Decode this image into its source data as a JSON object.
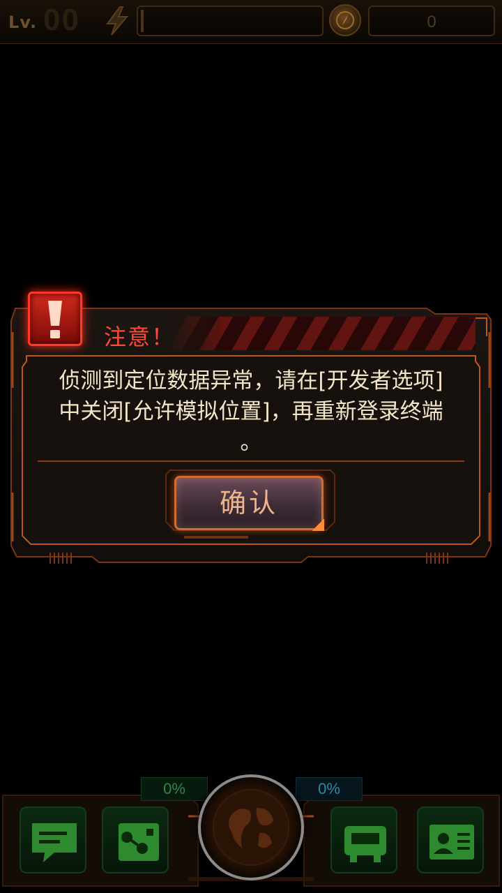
{
  "topbar": {
    "level_label": "Lv.",
    "level_value": "00",
    "coins": "0",
    "icons": {
      "energy": "lightning-icon",
      "coin": "compass-coin-icon"
    }
  },
  "dialog": {
    "title": "注意！",
    "message_line1": "侦测到定位数据异常，请在[开发者选项]",
    "message_line2": "中关闭[允许模拟位置]，再重新登录终端",
    "message_line3": "。",
    "confirm_label": "确认",
    "colors": {
      "accent": "#ff4a3a",
      "frame": "#c0551e",
      "text": "#f3e6c8"
    }
  },
  "bottom": {
    "left_percent": "0%",
    "right_percent": "0%",
    "nav_icons": [
      "chat-icon",
      "share-icon",
      "device-icon",
      "profile-card-icon"
    ],
    "center_icon": "globe-icon"
  }
}
